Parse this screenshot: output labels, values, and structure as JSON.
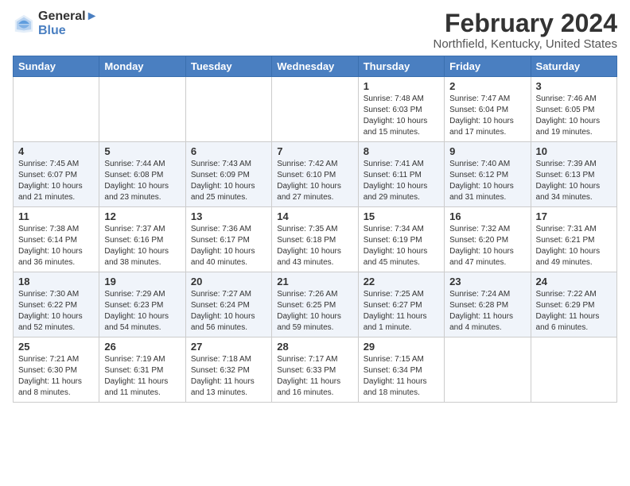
{
  "header": {
    "logo_line1": "General",
    "logo_line2": "Blue",
    "title": "February 2024",
    "subtitle": "Northfield, Kentucky, United States"
  },
  "weekdays": [
    "Sunday",
    "Monday",
    "Tuesday",
    "Wednesday",
    "Thursday",
    "Friday",
    "Saturday"
  ],
  "weeks": [
    [
      {
        "num": "",
        "info": ""
      },
      {
        "num": "",
        "info": ""
      },
      {
        "num": "",
        "info": ""
      },
      {
        "num": "",
        "info": ""
      },
      {
        "num": "1",
        "info": "Sunrise: 7:48 AM\nSunset: 6:03 PM\nDaylight: 10 hours\nand 15 minutes."
      },
      {
        "num": "2",
        "info": "Sunrise: 7:47 AM\nSunset: 6:04 PM\nDaylight: 10 hours\nand 17 minutes."
      },
      {
        "num": "3",
        "info": "Sunrise: 7:46 AM\nSunset: 6:05 PM\nDaylight: 10 hours\nand 19 minutes."
      }
    ],
    [
      {
        "num": "4",
        "info": "Sunrise: 7:45 AM\nSunset: 6:07 PM\nDaylight: 10 hours\nand 21 minutes."
      },
      {
        "num": "5",
        "info": "Sunrise: 7:44 AM\nSunset: 6:08 PM\nDaylight: 10 hours\nand 23 minutes."
      },
      {
        "num": "6",
        "info": "Sunrise: 7:43 AM\nSunset: 6:09 PM\nDaylight: 10 hours\nand 25 minutes."
      },
      {
        "num": "7",
        "info": "Sunrise: 7:42 AM\nSunset: 6:10 PM\nDaylight: 10 hours\nand 27 minutes."
      },
      {
        "num": "8",
        "info": "Sunrise: 7:41 AM\nSunset: 6:11 PM\nDaylight: 10 hours\nand 29 minutes."
      },
      {
        "num": "9",
        "info": "Sunrise: 7:40 AM\nSunset: 6:12 PM\nDaylight: 10 hours\nand 31 minutes."
      },
      {
        "num": "10",
        "info": "Sunrise: 7:39 AM\nSunset: 6:13 PM\nDaylight: 10 hours\nand 34 minutes."
      }
    ],
    [
      {
        "num": "11",
        "info": "Sunrise: 7:38 AM\nSunset: 6:14 PM\nDaylight: 10 hours\nand 36 minutes."
      },
      {
        "num": "12",
        "info": "Sunrise: 7:37 AM\nSunset: 6:16 PM\nDaylight: 10 hours\nand 38 minutes."
      },
      {
        "num": "13",
        "info": "Sunrise: 7:36 AM\nSunset: 6:17 PM\nDaylight: 10 hours\nand 40 minutes."
      },
      {
        "num": "14",
        "info": "Sunrise: 7:35 AM\nSunset: 6:18 PM\nDaylight: 10 hours\nand 43 minutes."
      },
      {
        "num": "15",
        "info": "Sunrise: 7:34 AM\nSunset: 6:19 PM\nDaylight: 10 hours\nand 45 minutes."
      },
      {
        "num": "16",
        "info": "Sunrise: 7:32 AM\nSunset: 6:20 PM\nDaylight: 10 hours\nand 47 minutes."
      },
      {
        "num": "17",
        "info": "Sunrise: 7:31 AM\nSunset: 6:21 PM\nDaylight: 10 hours\nand 49 minutes."
      }
    ],
    [
      {
        "num": "18",
        "info": "Sunrise: 7:30 AM\nSunset: 6:22 PM\nDaylight: 10 hours\nand 52 minutes."
      },
      {
        "num": "19",
        "info": "Sunrise: 7:29 AM\nSunset: 6:23 PM\nDaylight: 10 hours\nand 54 minutes."
      },
      {
        "num": "20",
        "info": "Sunrise: 7:27 AM\nSunset: 6:24 PM\nDaylight: 10 hours\nand 56 minutes."
      },
      {
        "num": "21",
        "info": "Sunrise: 7:26 AM\nSunset: 6:25 PM\nDaylight: 10 hours\nand 59 minutes."
      },
      {
        "num": "22",
        "info": "Sunrise: 7:25 AM\nSunset: 6:27 PM\nDaylight: 11 hours\nand 1 minute."
      },
      {
        "num": "23",
        "info": "Sunrise: 7:24 AM\nSunset: 6:28 PM\nDaylight: 11 hours\nand 4 minutes."
      },
      {
        "num": "24",
        "info": "Sunrise: 7:22 AM\nSunset: 6:29 PM\nDaylight: 11 hours\nand 6 minutes."
      }
    ],
    [
      {
        "num": "25",
        "info": "Sunrise: 7:21 AM\nSunset: 6:30 PM\nDaylight: 11 hours\nand 8 minutes."
      },
      {
        "num": "26",
        "info": "Sunrise: 7:19 AM\nSunset: 6:31 PM\nDaylight: 11 hours\nand 11 minutes."
      },
      {
        "num": "27",
        "info": "Sunrise: 7:18 AM\nSunset: 6:32 PM\nDaylight: 11 hours\nand 13 minutes."
      },
      {
        "num": "28",
        "info": "Sunrise: 7:17 AM\nSunset: 6:33 PM\nDaylight: 11 hours\nand 16 minutes."
      },
      {
        "num": "29",
        "info": "Sunrise: 7:15 AM\nSunset: 6:34 PM\nDaylight: 11 hours\nand 18 minutes."
      },
      {
        "num": "",
        "info": ""
      },
      {
        "num": "",
        "info": ""
      }
    ]
  ]
}
